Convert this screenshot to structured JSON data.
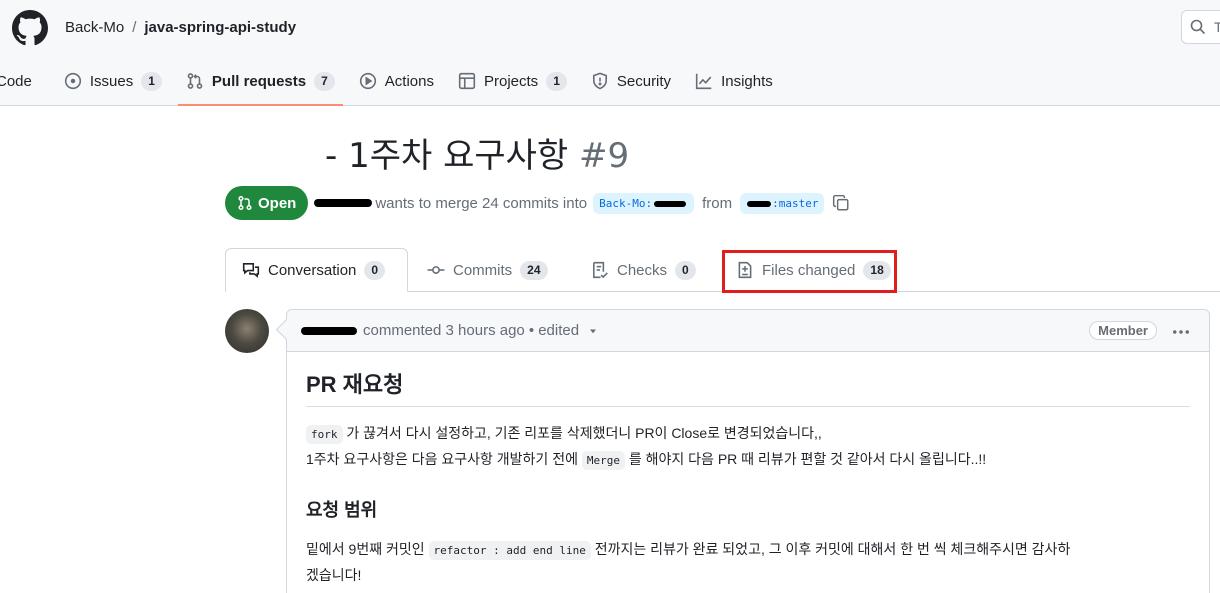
{
  "header": {
    "owner": "Back-Mo",
    "separator": "/",
    "repo": "java-spring-api-study",
    "search_placeholder": "T"
  },
  "nav": {
    "code": "Code",
    "issues": "Issues",
    "issues_count": "1",
    "pulls": "Pull requests",
    "pulls_count": "7",
    "actions": "Actions",
    "projects": "Projects",
    "projects_count": "1",
    "security": "Security",
    "insights": "Insights"
  },
  "pr": {
    "title": "- 1주차 요구사항",
    "number": "#9",
    "state": "Open",
    "merge_text": "wants to merge 24 commits into",
    "base_branch": "Back-Mo:",
    "from_text": "from",
    "head_branch": ":master"
  },
  "tabs": {
    "conversation": "Conversation",
    "conversation_count": "0",
    "commits": "Commits",
    "commits_count": "24",
    "checks": "Checks",
    "checks_count": "0",
    "files": "Files changed",
    "files_count": "18"
  },
  "comment": {
    "meta": "commented 3 hours ago •",
    "edited": "edited",
    "role": "Member",
    "h2": "PR 재요청",
    "p1_code": "fork",
    "p1_text": "가 끊겨서 다시 설정하고, 기존 리포를 삭제했더니 PR이 Close로 변경되었습니다,,",
    "p2_text_a": "1주차 요구사항은 다음 요구사항 개발하기 전에",
    "p2_code": "Merge",
    "p2_text_b": "를 해야지 다음 PR 때 리뷰가 편할 것 같아서 다시 올립니다..!!",
    "h3": "요청 범위",
    "p3_text_a": "밑에서 9번째 커밋인",
    "p3_code": "refactor : add end line",
    "p3_text_b": "전까지는 리뷰가 완료 되었고, 그 이후 커밋에 대해서 한 번 씩 체크해주시면 감사하",
    "p3_text_c": "겠습니다!"
  },
  "colors": {
    "open_green": "#1f883d",
    "selected_underline": "#fd8c73",
    "highlight_red": "#e01e1e",
    "branch_blue": "#0969da"
  }
}
